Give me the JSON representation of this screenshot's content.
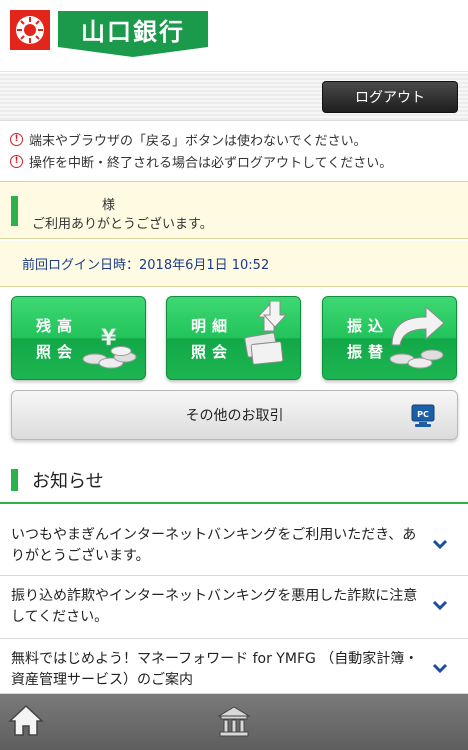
{
  "header": {
    "bank_name": "山口銀行"
  },
  "toolbar": {
    "logout_label": "ログアウト"
  },
  "notices": [
    {
      "icon": "alert-icon",
      "text": "端末やブラウザの「戻る」ボタンは使わないでください。"
    },
    {
      "icon": "alert-icon",
      "text": "操作を中断・終了される場合は必ずログアウトしてください。"
    }
  ],
  "welcome": {
    "name_suffix": "様",
    "thanks": "ご利用ありがとうございます。"
  },
  "last_login": {
    "text": "前回ログイン日時：2018年6月1日 10:52"
  },
  "menu": {
    "balance": {
      "line1": "残高",
      "line2": "照会",
      "icon": "yen-coins-icon"
    },
    "detail": {
      "line1": "明細",
      "line2": "照会",
      "icon": "passbook-arrows-icon"
    },
    "transfer": {
      "line1": "振込",
      "line2": "振替",
      "icon": "transfer-arrow-icon"
    },
    "other": {
      "label": "その他のお取引",
      "icon": "pc-icon"
    }
  },
  "news": {
    "title": "お知らせ",
    "items": [
      {
        "text": "いつもやまぎんインターネットバンキングをご利用いただき、ありがとうございます。"
      },
      {
        "text": "振り込め詐欺やインターネットバンキングを悪用した詐欺に注意してください。"
      },
      {
        "text": "無料ではじめよう！マネーフォワード for YMFG （自動家計簿・資産管理サービス）のご案内"
      }
    ]
  },
  "colors": {
    "brand_green": "#1a9a4a",
    "accent_green": "#2bb24c",
    "alert_red": "#d0202a",
    "link_blue": "#1a3b8a"
  },
  "bottom_nav": {
    "home_icon": "home-icon",
    "bank_icon": "bank-building-icon"
  }
}
